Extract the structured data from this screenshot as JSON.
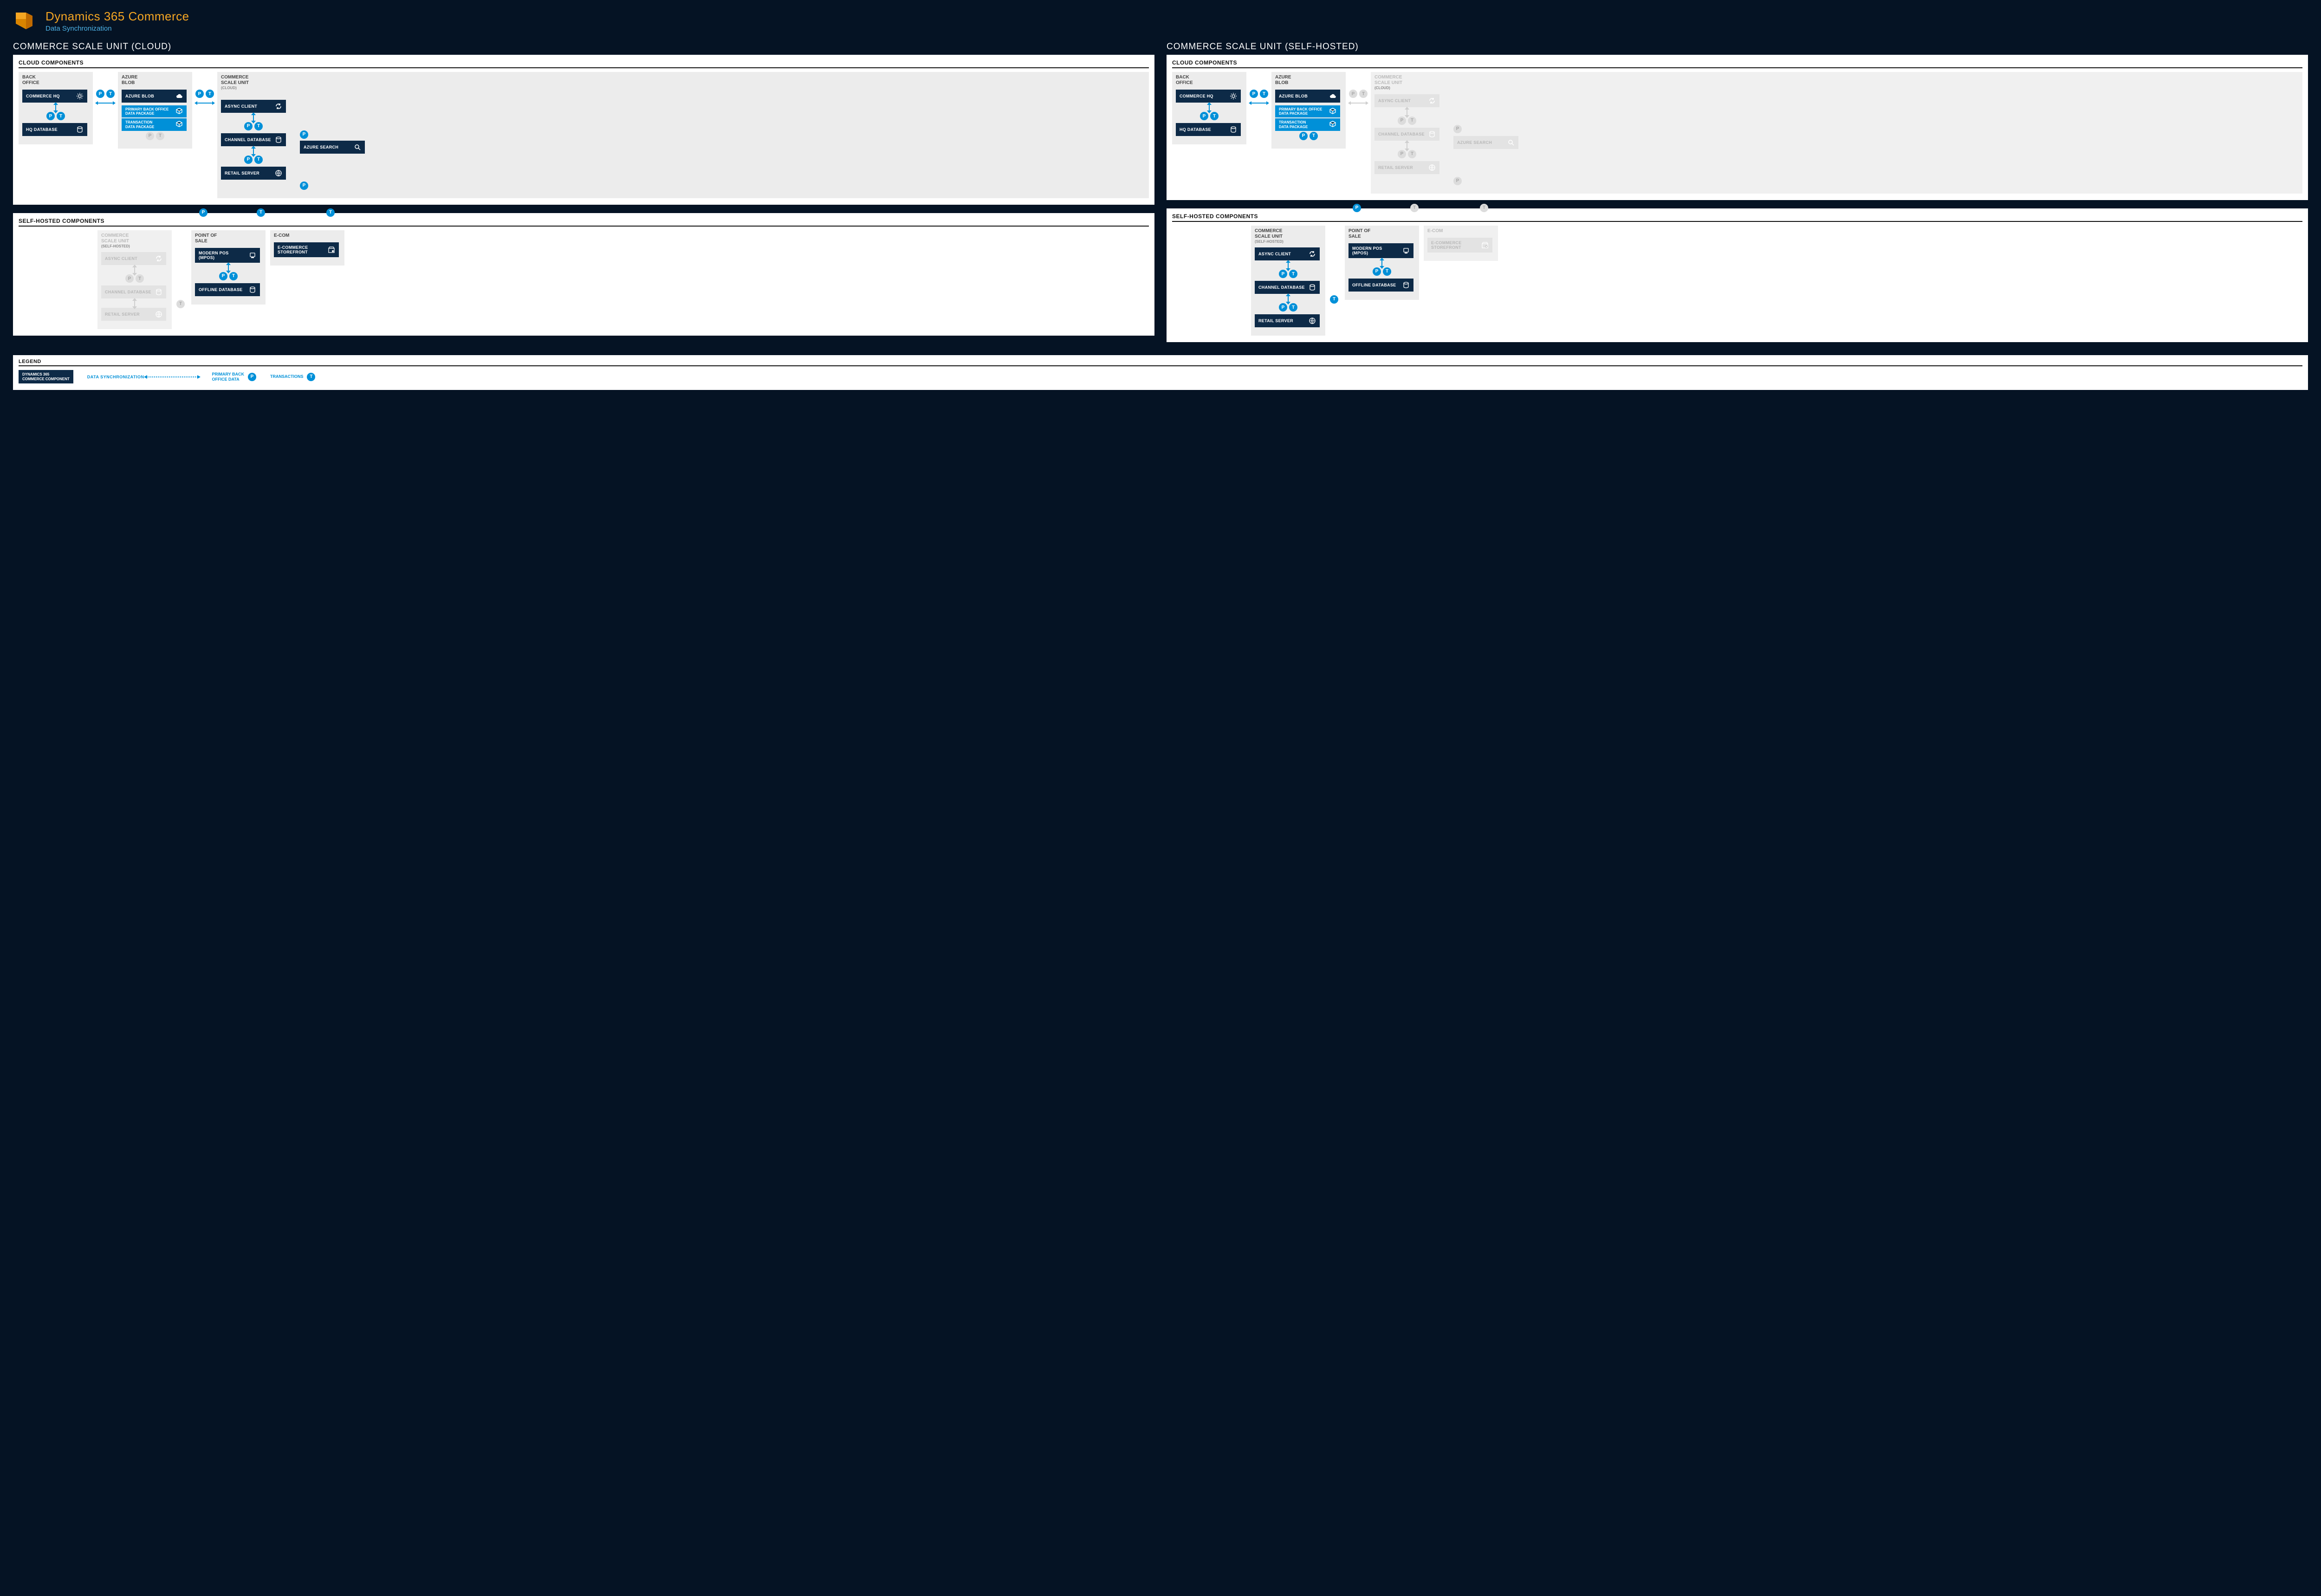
{
  "header": {
    "title": "Dynamics 365 Commerce",
    "subtitle": "Data Synchronization"
  },
  "badges": {
    "p": "P",
    "t": "T"
  },
  "scenarioA": {
    "title": "COMMERCE SCALE UNIT (CLOUD)",
    "cloud": {
      "panel": "CLOUD COMPONENTS",
      "backOffice": {
        "zone": "BACK\nOFFICE",
        "hq": "COMMERCE HQ",
        "hqdb": "HQ DATABASE"
      },
      "blob": {
        "zone": "AZURE\nBLOB",
        "blob": "AZURE BLOB",
        "pkgPrimary": "PRIMARY BACK OFFICE\nDATA PACKAGE",
        "pkgTxn": "TRANSACTION\nDATA PACKAGE"
      },
      "csu": {
        "zone": "COMMERCE\nSCALE UNIT",
        "sub": "(CLOUD)",
        "async": "ASYNC CLIENT",
        "chdb": "CHANNEL DATABASE",
        "retail": "RETAIL SERVER",
        "search": "AZURE SEARCH"
      }
    },
    "self": {
      "panel": "SELF-HOSTED COMPONENTS",
      "csuSelf": {
        "zone": "COMMERCE\nSCALE UNIT",
        "sub": "(SELF-HOSTED)",
        "async": "ASYNC CLIENT",
        "chdb": "CHANNEL DATABASE",
        "retail": "RETAIL SERVER"
      },
      "pos": {
        "zone": "POINT OF\nSALE",
        "mpos": "MODERN POS\n(MPOS)",
        "offline": "OFFLINE DATABASE"
      },
      "ecom": {
        "zone": "E-COM",
        "store": "E-COMMERCE\nSTOREFRONT"
      }
    }
  },
  "scenarioB": {
    "title": "COMMERCE SCALE UNIT (SELF-HOSTED)",
    "cloud": {
      "panel": "CLOUD COMPONENTS",
      "backOffice": {
        "zone": "BACK\nOFFICE",
        "hq": "COMMERCE HQ",
        "hqdb": "HQ DATABASE"
      },
      "blob": {
        "zone": "AZURE\nBLOB",
        "blob": "AZURE BLOB",
        "pkgPrimary": "PRIMARY BACK OFFICE\nDATA PACKAGE",
        "pkgTxn": "TRANSACTION\nDATA PACKAGE"
      },
      "csu": {
        "zone": "COMMERCE\nSCALE UNIT",
        "sub": "(CLOUD)",
        "async": "ASYNC CLIENT",
        "chdb": "CHANNEL DATABASE",
        "retail": "RETAIL SERVER",
        "search": "AZURE SEARCH"
      }
    },
    "self": {
      "panel": "SELF-HOSTED COMPONENTS",
      "csuSelf": {
        "zone": "COMMERCE\nSCALE UNIT",
        "sub": "(SELF-HOSTED)",
        "async": "ASYNC CLIENT",
        "chdb": "CHANNEL DATABASE",
        "retail": "RETAIL SERVER"
      },
      "pos": {
        "zone": "POINT OF\nSALE",
        "mpos": "MODERN POS\n(MPOS)",
        "offline": "OFFLINE DATABASE"
      },
      "ecom": {
        "zone": "E-COM",
        "store": "E-COMMERCE\nSTOREFRONT"
      }
    }
  },
  "legend": {
    "title": "LEGEND",
    "chip": "DYNAMICS 365\nCOMMERCE COMPONENT",
    "flow": "DATA SYNCHRONIZATION",
    "primary": "PRIMARY BACK\nOFFICE DATA",
    "txn": "TRANSACTIONS"
  }
}
